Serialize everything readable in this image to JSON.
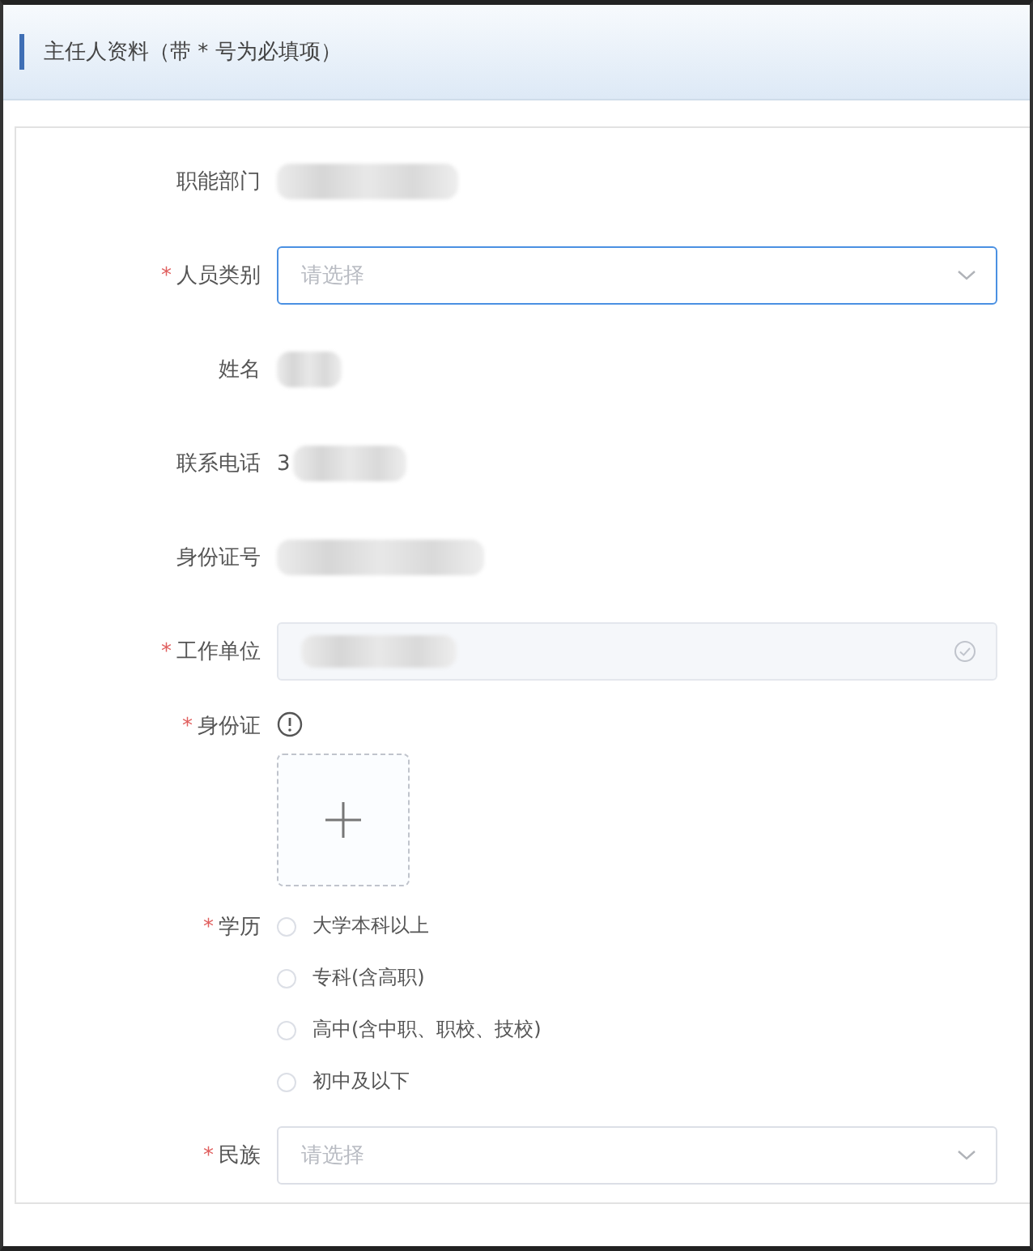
{
  "header": {
    "title": "主任人资料（带 * 号为必填项）"
  },
  "fields": [
    {
      "kind": "redacted",
      "label": "职能部门"
    },
    {
      "kind": "select",
      "label": "人员类别",
      "required_mark": "*",
      "placeholder": "请选择",
      "focused": true
    },
    {
      "kind": "redacted",
      "label": "姓名"
    },
    {
      "kind": "redacted",
      "label": "联系电话",
      "value": "3"
    },
    {
      "kind": "redacted",
      "label": "身份证号"
    },
    {
      "kind": "disabled-input",
      "label": "工作单位",
      "required_mark": "*"
    },
    {
      "kind": "upload",
      "label": "身份证",
      "required_mark": "*"
    },
    {
      "kind": "radio",
      "label": "学历",
      "required_mark": "*",
      "options": [
        {
          "label": "大学本科以上",
          "selected": false
        },
        {
          "label": "专科(含高职)",
          "selected": false
        },
        {
          "label": "高中(含中职、职校、技校)",
          "selected": false
        },
        {
          "label": "初中及以下",
          "selected": false
        }
      ]
    },
    {
      "kind": "select",
      "label": "民族",
      "required_mark": "*",
      "placeholder": "请选择",
      "focused": false
    }
  ]
}
